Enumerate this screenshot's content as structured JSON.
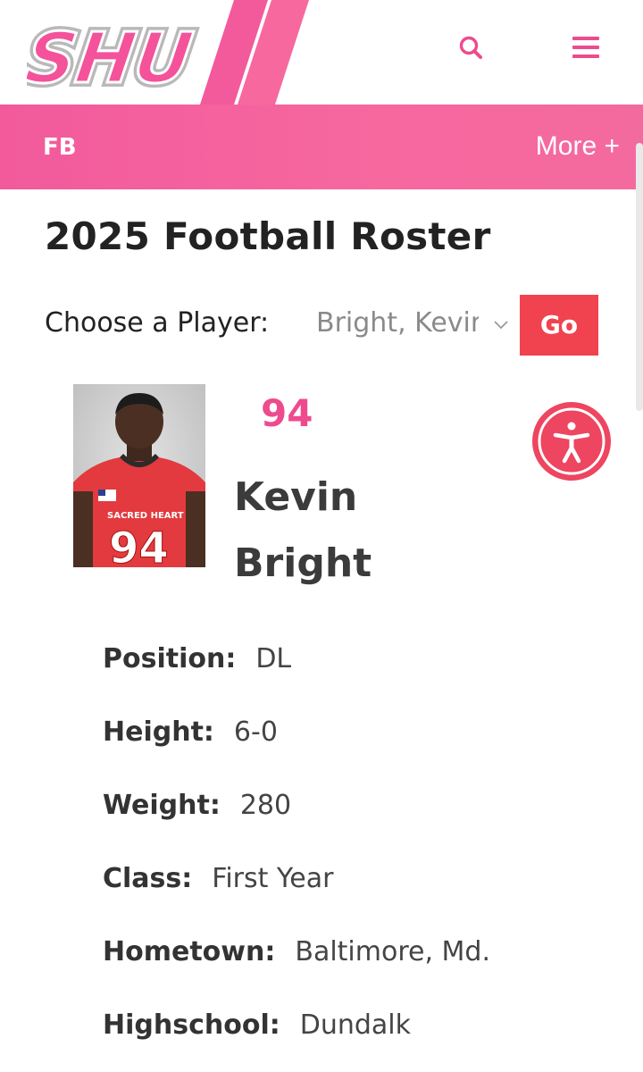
{
  "header": {
    "logo_text": "SHU",
    "search_icon": "search-icon",
    "menu_icon": "hamburger-menu-icon"
  },
  "nav": {
    "section": "FB",
    "more": "More +"
  },
  "page": {
    "title": "2025 Football Roster"
  },
  "chooser": {
    "label": "Choose a Player:",
    "selected": "Bright, Kevin",
    "go": "Go"
  },
  "player": {
    "number": "94",
    "first_name": "Kevin",
    "last_name": "Bright",
    "photo_jersey_text": "SACRED HEART",
    "photo_jersey_number": "94",
    "details": [
      {
        "label": "Position:",
        "value": "DL"
      },
      {
        "label": "Height:",
        "value": "6-0"
      },
      {
        "label": "Weight:",
        "value": "280"
      },
      {
        "label": "Class:",
        "value": "First Year"
      },
      {
        "label": "Hometown:",
        "value": "Baltimore, Md."
      },
      {
        "label": "Highschool:",
        "value": "Dundalk"
      }
    ]
  },
  "colors": {
    "brand_pink": "#f25a9c",
    "go_red": "#f0434f",
    "number_pink": "#ee4b8f",
    "accessibility_red": "#ee4560"
  }
}
